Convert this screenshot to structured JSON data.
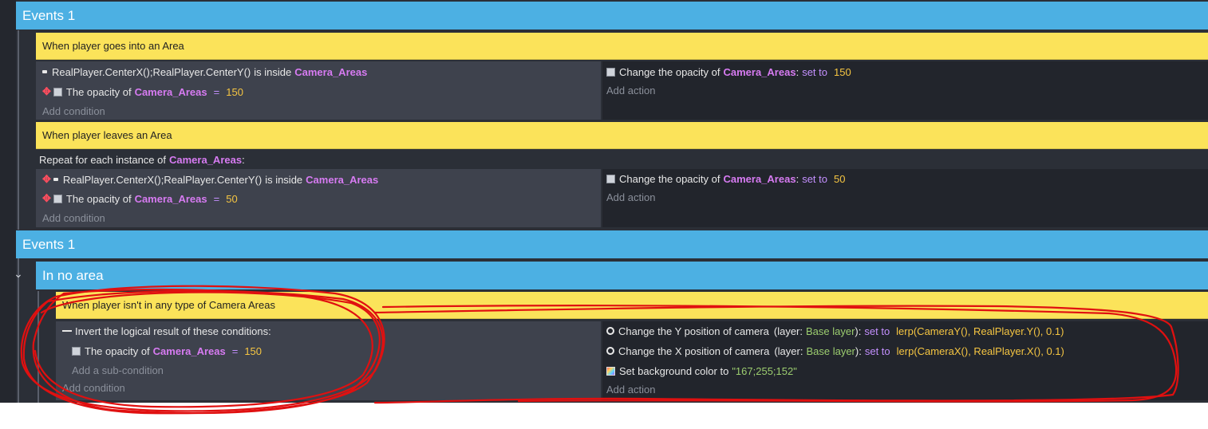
{
  "groups": [
    {
      "title": "Events 1"
    },
    {
      "title": "Events 1"
    }
  ],
  "subgroup": {
    "title": "In no area"
  },
  "event1": {
    "comment": "When player goes into an Area",
    "cond1": {
      "expr": "RealPlayer.CenterX();RealPlayer.CenterY()",
      "mid": "is inside",
      "obj": "Camera_Areas"
    },
    "cond2": {
      "pre": "The opacity of",
      "obj": "Camera_Areas",
      "op": "=",
      "val": "150"
    },
    "add_condition": "Add condition",
    "action1": {
      "pre": "Change the opacity of",
      "obj": "Camera_Areas",
      "colon": ":",
      "op": "set to",
      "val": "150"
    },
    "add_action": "Add action"
  },
  "event2": {
    "comment": "When player leaves an Area",
    "repeat": {
      "pre": "Repeat for each instance of",
      "obj": "Camera_Areas",
      "colon": ":"
    },
    "cond1": {
      "expr": "RealPlayer.CenterX();RealPlayer.CenterY()",
      "mid": "is inside",
      "obj": "Camera_Areas"
    },
    "cond2": {
      "pre": "The opacity of",
      "obj": "Camera_Areas",
      "op": "=",
      "val": "50"
    },
    "add_condition": "Add condition",
    "action1": {
      "pre": "Change the opacity of",
      "obj": "Camera_Areas",
      "colon": ":",
      "op": "set to",
      "val": "50"
    },
    "add_action": "Add action"
  },
  "event3": {
    "comment": "When player isn't in any type of Camera Areas",
    "invert": "Invert the logical result of these conditions:",
    "sub_cond": {
      "pre": "The opacity of",
      "obj": "Camera_Areas",
      "op": "=",
      "val": "150"
    },
    "add_sub_condition": "Add a sub-condition",
    "add_condition": "Add condition",
    "action1": {
      "pre": "Change the Y position of camera",
      "layer_pre": "(layer:",
      "layer": "Base layer",
      "layer_post": "):",
      "op": "set to",
      "val": "lerp(CameraY(), RealPlayer.Y(), 0.1)"
    },
    "action2": {
      "pre": "Change the X position of camera",
      "layer_pre": "(layer:",
      "layer": "Base layer",
      "layer_post": "):",
      "op": "set to",
      "val": "lerp(CameraX(), RealPlayer.X(), 0.1)"
    },
    "action3": {
      "pre": "Set background color to",
      "val": "\"167;255;152\""
    },
    "add_action": "Add action"
  },
  "colors": {
    "group_bar": "#4cb0e3",
    "comment": "#fbe35a",
    "object": "#d77bf2",
    "keyword": "#c490ff",
    "number": "#f5c542",
    "layer": "#9ccd6f",
    "annotation": "#e01010"
  }
}
